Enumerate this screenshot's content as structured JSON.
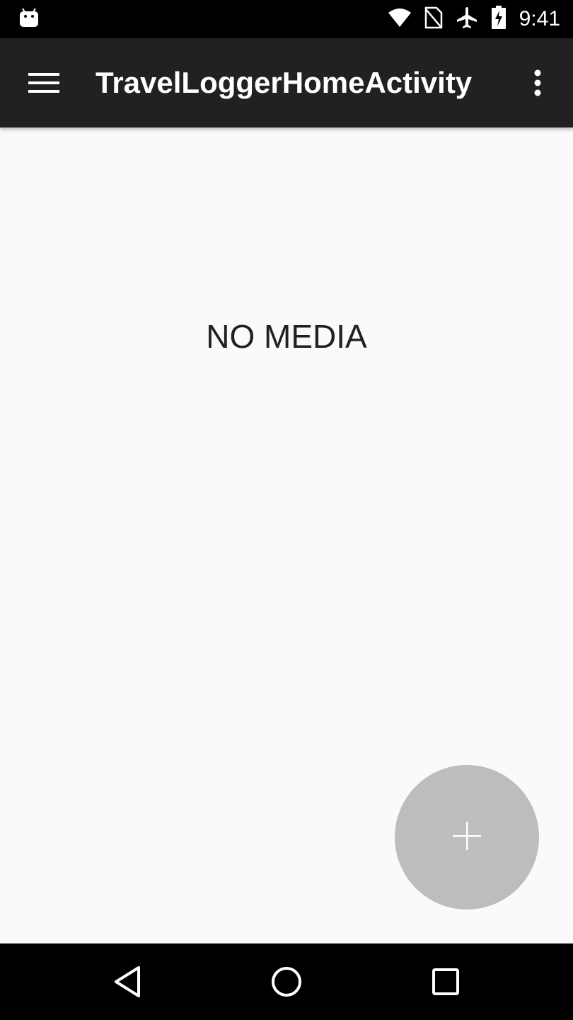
{
  "status_bar": {
    "time": "9:41",
    "icons": [
      "android-debug-icon",
      "wifi-icon",
      "no-sim-icon",
      "airplane-mode-icon",
      "battery-charging-icon"
    ]
  },
  "app_bar": {
    "title": "TravelLoggerHomeActivity",
    "background": "#212121",
    "menu_icon": "hamburger-menu-icon",
    "overflow_icon": "more-vert-icon"
  },
  "main": {
    "empty_message": "NO MEDIA",
    "background": "#fafafa"
  },
  "fab": {
    "icon": "plus-icon",
    "color": "#bdbdbd"
  },
  "nav_bar": {
    "buttons": [
      "back-icon",
      "home-icon",
      "recents-icon"
    ]
  }
}
